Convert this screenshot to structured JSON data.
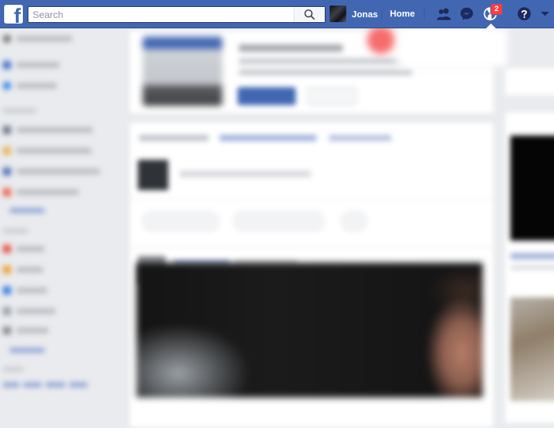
{
  "topbar": {
    "logo_letter": "f",
    "search": {
      "placeholder": "Search",
      "value": ""
    },
    "profile": {
      "name": "Jonas"
    },
    "home_label": "Home",
    "notification_count": "2"
  },
  "colors": {
    "brand_blue": "#4267b2",
    "topbar_border": "#29487d",
    "badge_red": "#fa3e3e",
    "page_background": "#e9ebee"
  },
  "icons": {
    "search": "search-icon",
    "friends": "friend-requests-icon",
    "messenger": "messenger-icon",
    "notifications": "globe-notifications-icon",
    "help": "help-icon",
    "account_menu": "caret-down-icon"
  },
  "background_state": "blurred"
}
